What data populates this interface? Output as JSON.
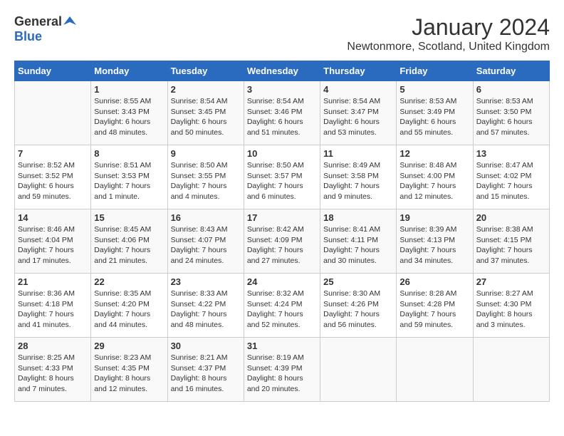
{
  "header": {
    "logo_general": "General",
    "logo_blue": "Blue",
    "month_title": "January 2024",
    "location": "Newtonmore, Scotland, United Kingdom"
  },
  "weekdays": [
    "Sunday",
    "Monday",
    "Tuesday",
    "Wednesday",
    "Thursday",
    "Friday",
    "Saturday"
  ],
  "weeks": [
    [
      {
        "day": "",
        "sunrise": "",
        "sunset": "",
        "daylight": ""
      },
      {
        "day": "1",
        "sunrise": "Sunrise: 8:55 AM",
        "sunset": "Sunset: 3:43 PM",
        "daylight": "Daylight: 6 hours and 48 minutes."
      },
      {
        "day": "2",
        "sunrise": "Sunrise: 8:54 AM",
        "sunset": "Sunset: 3:45 PM",
        "daylight": "Daylight: 6 hours and 50 minutes."
      },
      {
        "day": "3",
        "sunrise": "Sunrise: 8:54 AM",
        "sunset": "Sunset: 3:46 PM",
        "daylight": "Daylight: 6 hours and 51 minutes."
      },
      {
        "day": "4",
        "sunrise": "Sunrise: 8:54 AM",
        "sunset": "Sunset: 3:47 PM",
        "daylight": "Daylight: 6 hours and 53 minutes."
      },
      {
        "day": "5",
        "sunrise": "Sunrise: 8:53 AM",
        "sunset": "Sunset: 3:49 PM",
        "daylight": "Daylight: 6 hours and 55 minutes."
      },
      {
        "day": "6",
        "sunrise": "Sunrise: 8:53 AM",
        "sunset": "Sunset: 3:50 PM",
        "daylight": "Daylight: 6 hours and 57 minutes."
      }
    ],
    [
      {
        "day": "7",
        "sunrise": "Sunrise: 8:52 AM",
        "sunset": "Sunset: 3:52 PM",
        "daylight": "Daylight: 6 hours and 59 minutes."
      },
      {
        "day": "8",
        "sunrise": "Sunrise: 8:51 AM",
        "sunset": "Sunset: 3:53 PM",
        "daylight": "Daylight: 7 hours and 1 minute."
      },
      {
        "day": "9",
        "sunrise": "Sunrise: 8:50 AM",
        "sunset": "Sunset: 3:55 PM",
        "daylight": "Daylight: 7 hours and 4 minutes."
      },
      {
        "day": "10",
        "sunrise": "Sunrise: 8:50 AM",
        "sunset": "Sunset: 3:57 PM",
        "daylight": "Daylight: 7 hours and 6 minutes."
      },
      {
        "day": "11",
        "sunrise": "Sunrise: 8:49 AM",
        "sunset": "Sunset: 3:58 PM",
        "daylight": "Daylight: 7 hours and 9 minutes."
      },
      {
        "day": "12",
        "sunrise": "Sunrise: 8:48 AM",
        "sunset": "Sunset: 4:00 PM",
        "daylight": "Daylight: 7 hours and 12 minutes."
      },
      {
        "day": "13",
        "sunrise": "Sunrise: 8:47 AM",
        "sunset": "Sunset: 4:02 PM",
        "daylight": "Daylight: 7 hours and 15 minutes."
      }
    ],
    [
      {
        "day": "14",
        "sunrise": "Sunrise: 8:46 AM",
        "sunset": "Sunset: 4:04 PM",
        "daylight": "Daylight: 7 hours and 17 minutes."
      },
      {
        "day": "15",
        "sunrise": "Sunrise: 8:45 AM",
        "sunset": "Sunset: 4:06 PM",
        "daylight": "Daylight: 7 hours and 21 minutes."
      },
      {
        "day": "16",
        "sunrise": "Sunrise: 8:43 AM",
        "sunset": "Sunset: 4:07 PM",
        "daylight": "Daylight: 7 hours and 24 minutes."
      },
      {
        "day": "17",
        "sunrise": "Sunrise: 8:42 AM",
        "sunset": "Sunset: 4:09 PM",
        "daylight": "Daylight: 7 hours and 27 minutes."
      },
      {
        "day": "18",
        "sunrise": "Sunrise: 8:41 AM",
        "sunset": "Sunset: 4:11 PM",
        "daylight": "Daylight: 7 hours and 30 minutes."
      },
      {
        "day": "19",
        "sunrise": "Sunrise: 8:39 AM",
        "sunset": "Sunset: 4:13 PM",
        "daylight": "Daylight: 7 hours and 34 minutes."
      },
      {
        "day": "20",
        "sunrise": "Sunrise: 8:38 AM",
        "sunset": "Sunset: 4:15 PM",
        "daylight": "Daylight: 7 hours and 37 minutes."
      }
    ],
    [
      {
        "day": "21",
        "sunrise": "Sunrise: 8:36 AM",
        "sunset": "Sunset: 4:18 PM",
        "daylight": "Daylight: 7 hours and 41 minutes."
      },
      {
        "day": "22",
        "sunrise": "Sunrise: 8:35 AM",
        "sunset": "Sunset: 4:20 PM",
        "daylight": "Daylight: 7 hours and 44 minutes."
      },
      {
        "day": "23",
        "sunrise": "Sunrise: 8:33 AM",
        "sunset": "Sunset: 4:22 PM",
        "daylight": "Daylight: 7 hours and 48 minutes."
      },
      {
        "day": "24",
        "sunrise": "Sunrise: 8:32 AM",
        "sunset": "Sunset: 4:24 PM",
        "daylight": "Daylight: 7 hours and 52 minutes."
      },
      {
        "day": "25",
        "sunrise": "Sunrise: 8:30 AM",
        "sunset": "Sunset: 4:26 PM",
        "daylight": "Daylight: 7 hours and 56 minutes."
      },
      {
        "day": "26",
        "sunrise": "Sunrise: 8:28 AM",
        "sunset": "Sunset: 4:28 PM",
        "daylight": "Daylight: 7 hours and 59 minutes."
      },
      {
        "day": "27",
        "sunrise": "Sunrise: 8:27 AM",
        "sunset": "Sunset: 4:30 PM",
        "daylight": "Daylight: 8 hours and 3 minutes."
      }
    ],
    [
      {
        "day": "28",
        "sunrise": "Sunrise: 8:25 AM",
        "sunset": "Sunset: 4:33 PM",
        "daylight": "Daylight: 8 hours and 7 minutes."
      },
      {
        "day": "29",
        "sunrise": "Sunrise: 8:23 AM",
        "sunset": "Sunset: 4:35 PM",
        "daylight": "Daylight: 8 hours and 12 minutes."
      },
      {
        "day": "30",
        "sunrise": "Sunrise: 8:21 AM",
        "sunset": "Sunset: 4:37 PM",
        "daylight": "Daylight: 8 hours and 16 minutes."
      },
      {
        "day": "31",
        "sunrise": "Sunrise: 8:19 AM",
        "sunset": "Sunset: 4:39 PM",
        "daylight": "Daylight: 8 hours and 20 minutes."
      },
      {
        "day": "",
        "sunrise": "",
        "sunset": "",
        "daylight": ""
      },
      {
        "day": "",
        "sunrise": "",
        "sunset": "",
        "daylight": ""
      },
      {
        "day": "",
        "sunrise": "",
        "sunset": "",
        "daylight": ""
      }
    ]
  ]
}
